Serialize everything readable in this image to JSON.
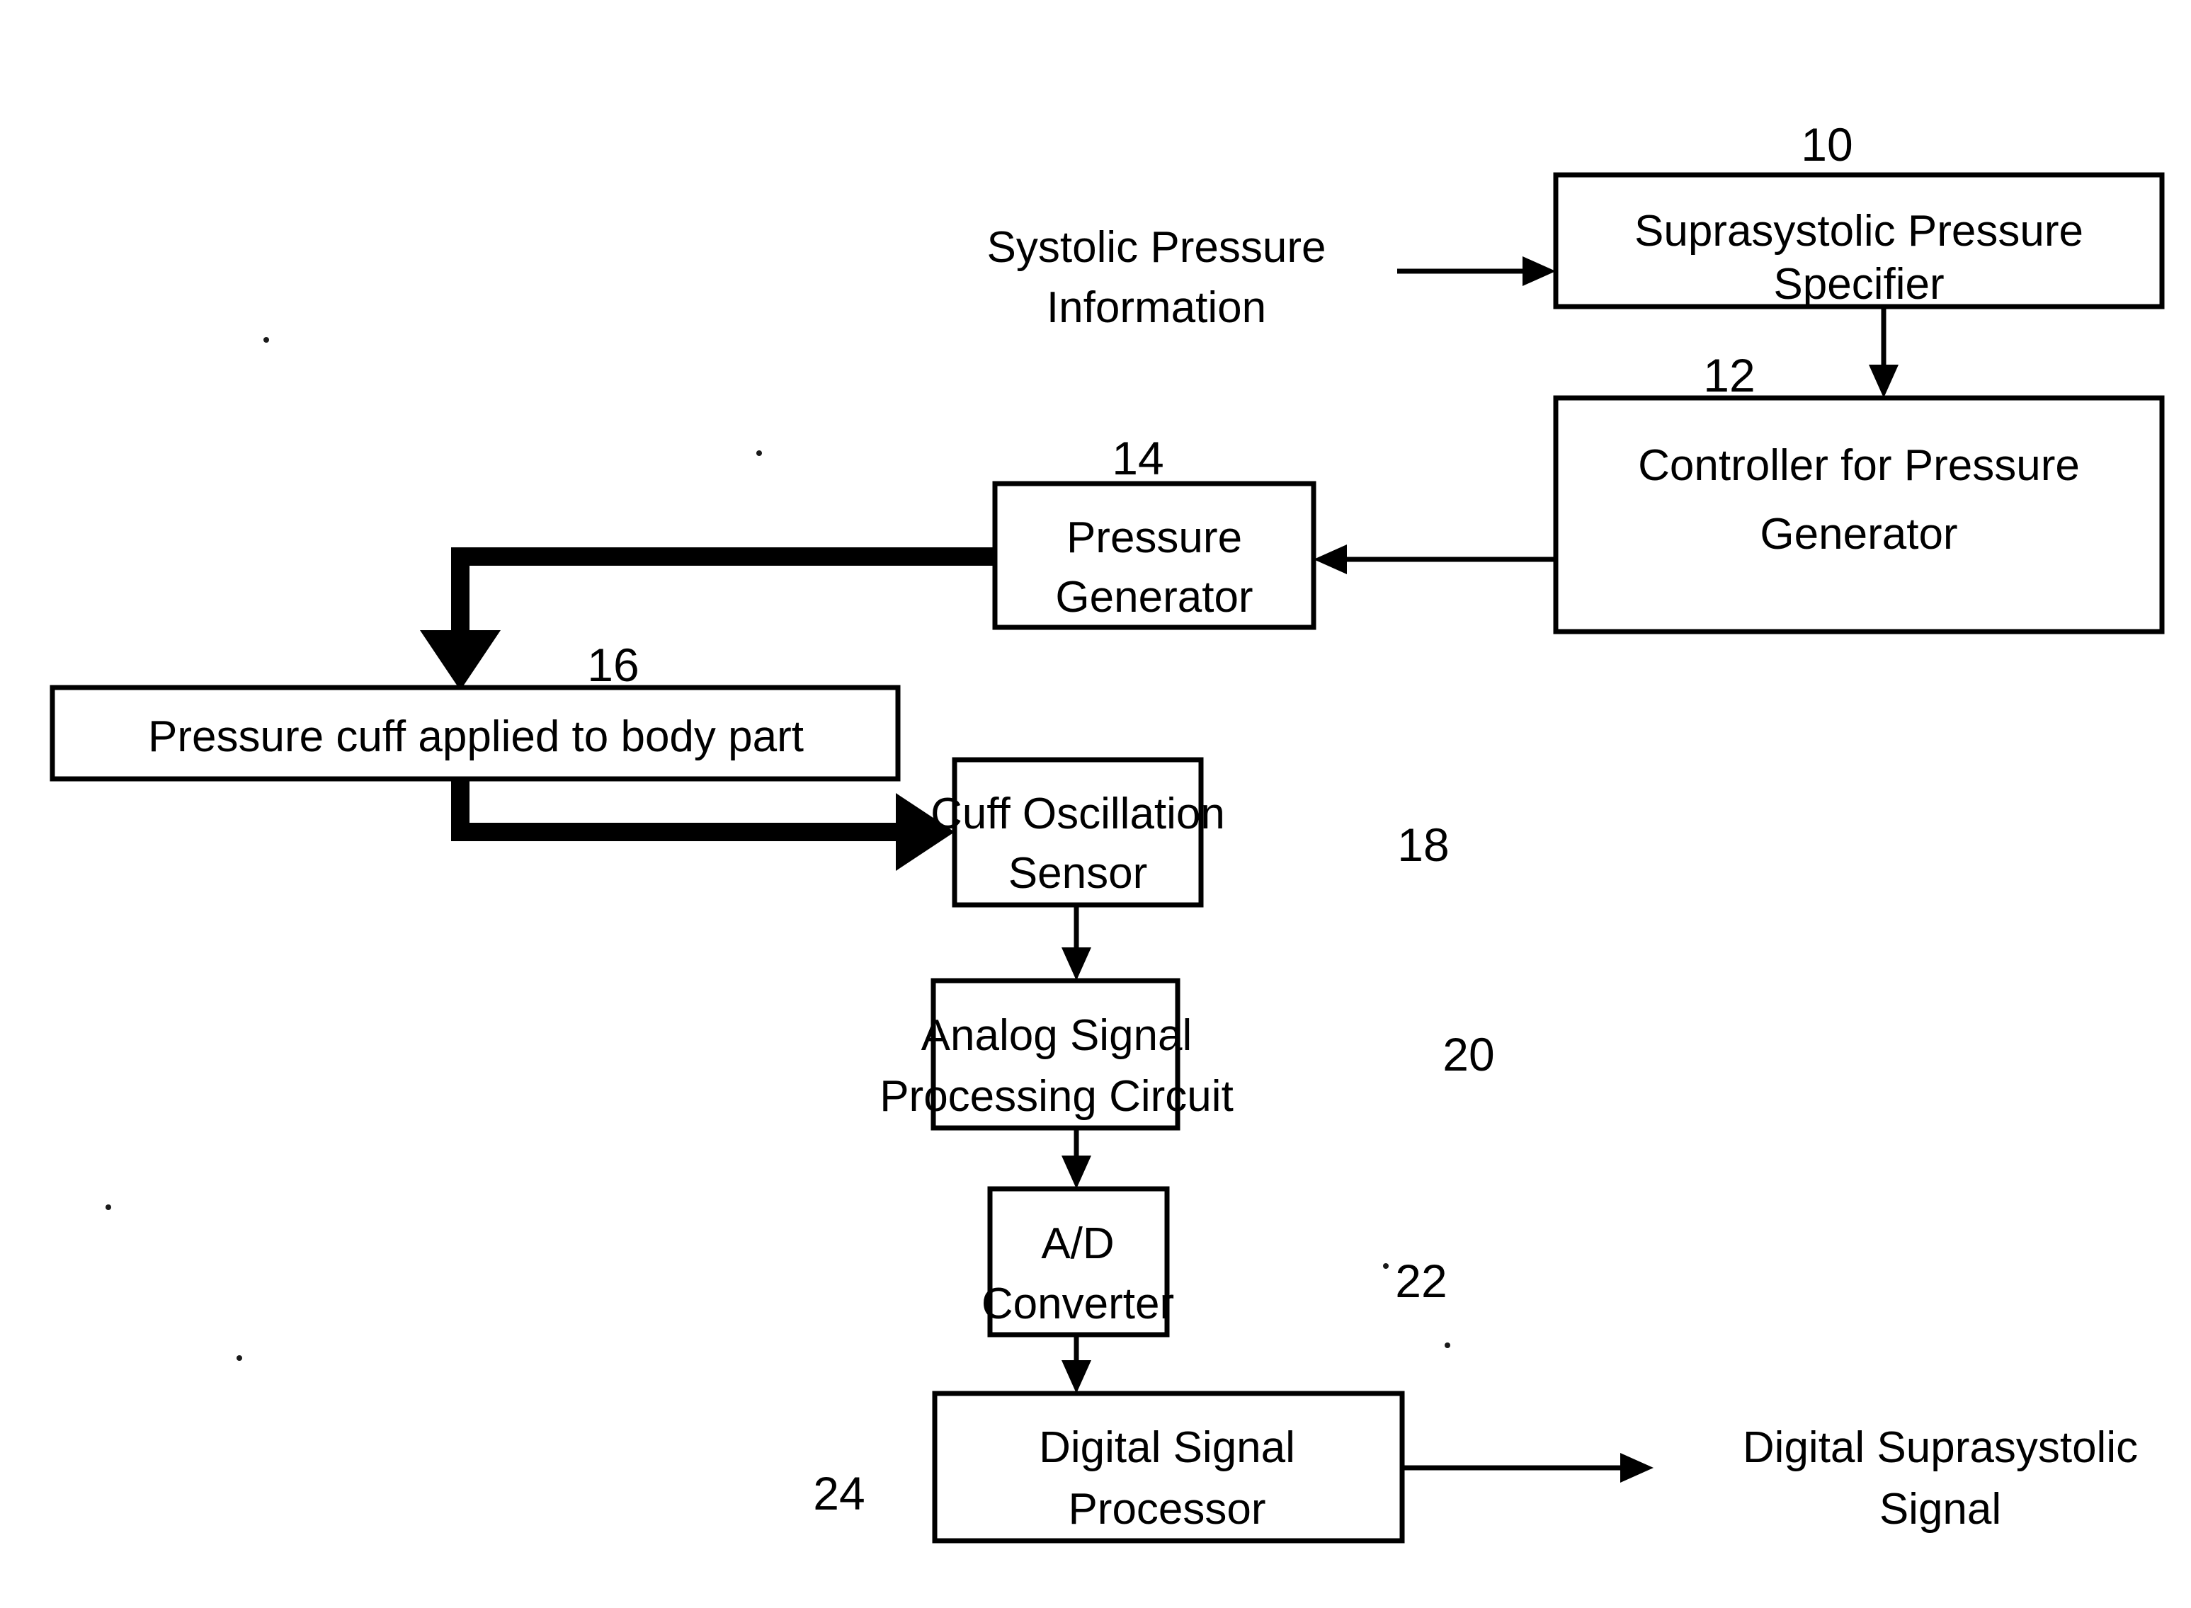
{
  "figure": {
    "type": "patent-block-diagram",
    "background_color": "#ffffff",
    "line_color": "#000000"
  },
  "blocks": {
    "suprasystolic_pressure_specifier": {
      "label_line1": "Suprasystolic Pressure",
      "label_line2": "Specifier",
      "ref": "10"
    },
    "controller_for_pressure_generator": {
      "label_line1": "Controller for Pressure",
      "label_line2": "Generator",
      "ref": "12"
    },
    "pressure_generator": {
      "label_line1": "Pressure",
      "label_line2": "Generator",
      "ref": "14"
    },
    "pressure_cuff": {
      "label_line1": "Pressure cuff applied to body part",
      "ref": "16"
    },
    "cuff_oscillation_sensor": {
      "label_line1": "Cuff Oscillation",
      "label_line2": "Sensor",
      "ref": "18"
    },
    "analog_signal_processing_circuit": {
      "label_line1": "Analog Signal",
      "label_line2": "Processing Circuit",
      "ref": "20"
    },
    "ad_converter": {
      "label_line1": "A/D",
      "label_line2": "Converter",
      "ref": "22"
    },
    "digital_signal_processor": {
      "label_line1": "Digital Signal",
      "label_line2": "Processor",
      "ref": "24"
    }
  },
  "free_labels": {
    "input_signal": {
      "line1": "Systolic Pressure",
      "line2": "Information"
    },
    "output_signal": {
      "line1": "Digital Suprasystolic",
      "line2": "Signal"
    }
  }
}
